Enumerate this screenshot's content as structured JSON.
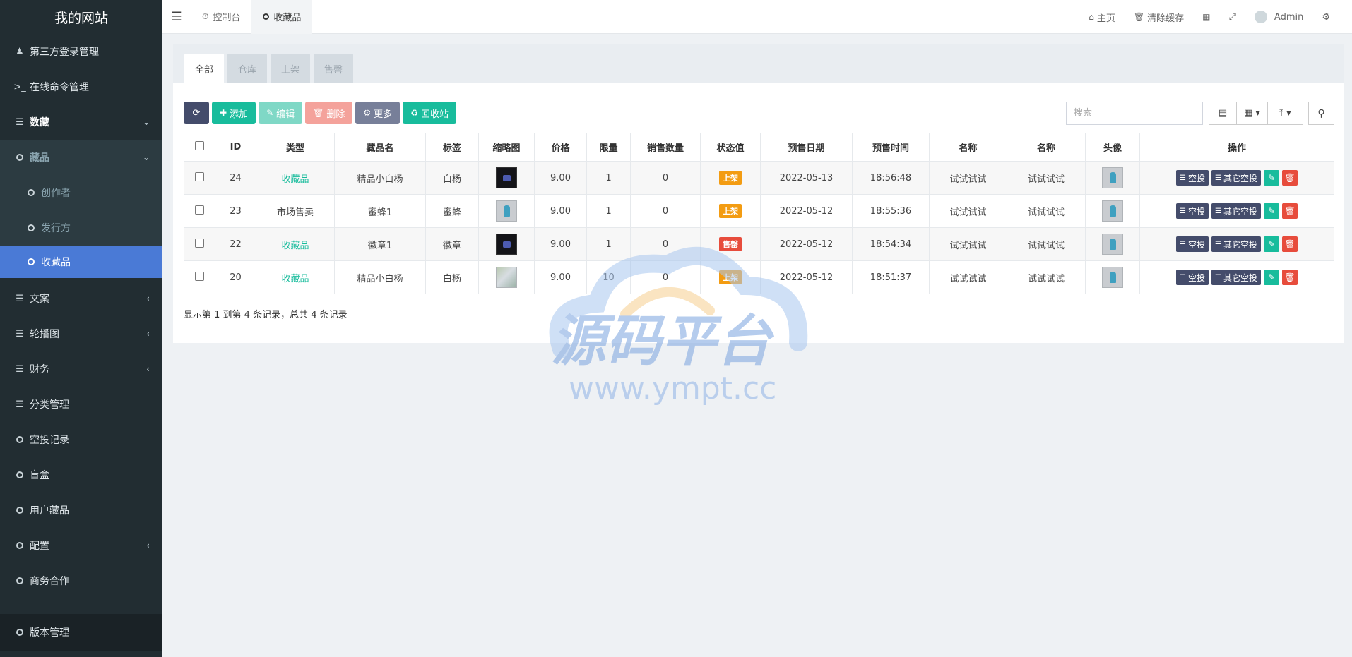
{
  "app": {
    "title": "我的网站"
  },
  "sidebar": {
    "items": [
      {
        "label": "第三方登录管理",
        "icon": "users-icon"
      },
      {
        "label": "在线命令管理",
        "icon": "terminal-icon"
      },
      {
        "label": "数藏",
        "icon": "list-icon"
      },
      {
        "label": "藏品",
        "icon": "circle-icon"
      },
      {
        "label": "创作者",
        "icon": "circle-icon"
      },
      {
        "label": "发行方",
        "icon": "circle-icon"
      },
      {
        "label": "收藏品",
        "icon": "circle-icon",
        "active": true
      },
      {
        "label": "文案",
        "icon": "list-icon"
      },
      {
        "label": "轮播图",
        "icon": "list-icon"
      },
      {
        "label": "财务",
        "icon": "list-icon"
      },
      {
        "label": "分类管理",
        "icon": "list-icon"
      },
      {
        "label": "空投记录",
        "icon": "circle-icon"
      },
      {
        "label": "盲盒",
        "icon": "circle-icon"
      },
      {
        "label": "用户藏品",
        "icon": "circle-icon"
      },
      {
        "label": "配置",
        "icon": "circle-icon"
      },
      {
        "label": "商务合作",
        "icon": "circle-icon"
      },
      {
        "label": "版本管理",
        "icon": "circle-icon"
      }
    ]
  },
  "topbar": {
    "tabs": [
      {
        "label": "控制台",
        "icon": "dashboard-icon"
      },
      {
        "label": "收藏品",
        "icon": "circle-icon"
      }
    ],
    "right": {
      "home": "主页",
      "clear_cache": "清除缓存",
      "user": "Admin"
    }
  },
  "panel": {
    "tabs": [
      "全部",
      "仓库",
      "上架",
      "售罄"
    ],
    "toolbar": {
      "add": "添加",
      "edit": "编辑",
      "delete": "删除",
      "more": "更多",
      "recycle": "回收站"
    },
    "search_placeholder": "搜索",
    "columns": [
      "ID",
      "类型",
      "藏品名",
      "标签",
      "缩略图",
      "价格",
      "限量",
      "销售数量",
      "状态值",
      "预售日期",
      "预售时间",
      "名称",
      "名称",
      "头像",
      "操作"
    ],
    "rows": [
      {
        "id": "24",
        "type": "收藏品",
        "type_link": true,
        "name": "精品小白杨",
        "tag": "白杨",
        "thumb": "dark",
        "price": "9.00",
        "limit": "1",
        "sold": "0",
        "status": "上架",
        "status_kind": "on",
        "date": "2022-05-13",
        "time": "18:56:48",
        "name1": "试试试试",
        "name2": "试试试试"
      },
      {
        "id": "23",
        "type": "市场售卖",
        "type_link": false,
        "name": "蜜蜂1",
        "tag": "蜜蜂",
        "thumb": "light",
        "price": "9.00",
        "limit": "1",
        "sold": "0",
        "status": "上架",
        "status_kind": "on",
        "date": "2022-05-12",
        "time": "18:55:36",
        "name1": "试试试试",
        "name2": "试试试试"
      },
      {
        "id": "22",
        "type": "收藏品",
        "type_link": true,
        "name": "徽章1",
        "tag": "徽章",
        "thumb": "dark",
        "price": "9.00",
        "limit": "1",
        "sold": "0",
        "status": "售罄",
        "status_kind": "sold",
        "date": "2022-05-12",
        "time": "18:54:34",
        "name1": "试试试试",
        "name2": "试试试试"
      },
      {
        "id": "20",
        "type": "收藏品",
        "type_link": true,
        "name": "精品小白杨",
        "tag": "白杨",
        "thumb": "scene",
        "price": "9.00",
        "limit": "10",
        "sold": "0",
        "status": "上架",
        "status_kind": "on",
        "date": "2022-05-12",
        "time": "18:51:37",
        "name1": "试试试试",
        "name2": "试试试试"
      }
    ],
    "row_actions": {
      "airdrop": "空投",
      "other_airdrop": "其它空投"
    },
    "records_text": "显示第 1 到第 4 条记录，总共 4 条记录"
  },
  "watermark": {
    "title": "源码平台",
    "url": "www.ympt.cc"
  },
  "colors": {
    "accent": "#18bc9c",
    "sidebar_bg": "#222d32",
    "active_nav": "#4a7ad6",
    "danger": "#e74c3c",
    "warning": "#f39c12"
  }
}
